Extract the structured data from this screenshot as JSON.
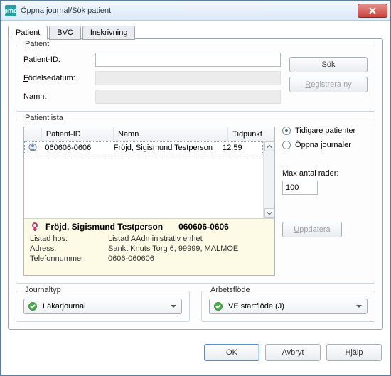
{
  "window": {
    "title": "Öppna journal/Sök patient",
    "icon_label": "pmo"
  },
  "tabs": [
    {
      "label": "Patient",
      "hotkey_index": 0,
      "selected": true
    },
    {
      "label": "BVC",
      "hotkey_index": 0,
      "selected": false
    },
    {
      "label": "Inskrivning",
      "hotkey_index": 0,
      "selected": false
    }
  ],
  "patient_group": {
    "legend": "Patient",
    "fields": {
      "id": {
        "label": "Patient-ID:",
        "hotkey_index": 0,
        "value": "",
        "enabled": true
      },
      "birth": {
        "label": "Födelsedatum:",
        "hotkey_index": 0,
        "value": "",
        "enabled": false
      },
      "name": {
        "label": "Namn:",
        "hotkey_index": 0,
        "value": "",
        "enabled": false
      }
    },
    "buttons": {
      "search": {
        "label": "Sök",
        "hotkey_index": 0
      },
      "register": {
        "label": "Registrera ny",
        "hotkey_index": 0,
        "enabled": false
      }
    }
  },
  "patientlist": {
    "legend": "Patientlista",
    "columns": {
      "id": "Patient-ID",
      "name": "Namn",
      "time": "Tidpunkt"
    },
    "rows": [
      {
        "id": "060606-0606",
        "name": "Fröjd, Sigismund Testperson",
        "time": "12:59",
        "selected": true
      }
    ],
    "detail": {
      "gender_icon": "female-icon",
      "name_bold": "Fröjd, Sigismund Testperson",
      "id_bold": "060606-0606",
      "listed_label": "Listad hos:",
      "listed_value": "Listad AAdministrativ enhet",
      "address_label": "Adress:",
      "address_value": "Sankt Knuts Torg 6, 99999, MALMOE",
      "phone_label": "Telefonnummer:",
      "phone_value": "0606-060606"
    },
    "side": {
      "radio_prev": {
        "label": "Tidigare patienter",
        "hotkey_index": 0,
        "checked": true
      },
      "radio_open": {
        "label": "Öppna journaler",
        "hotkey_index": 0,
        "checked": false
      },
      "max_rows_label": "Max antal rader:",
      "max_rows_value": "100",
      "update_btn": {
        "label": "Uppdatera",
        "hotkey_index": 0,
        "enabled": false
      }
    }
  },
  "journal_type": {
    "legend": "Journaltyp",
    "selected": "Läkarjournal"
  },
  "workflow": {
    "legend": "Arbetsflöde",
    "selected": "VE startflöde (J)"
  },
  "footer": {
    "ok": "OK",
    "cancel": "Avbryt",
    "help": "Hjälp"
  }
}
